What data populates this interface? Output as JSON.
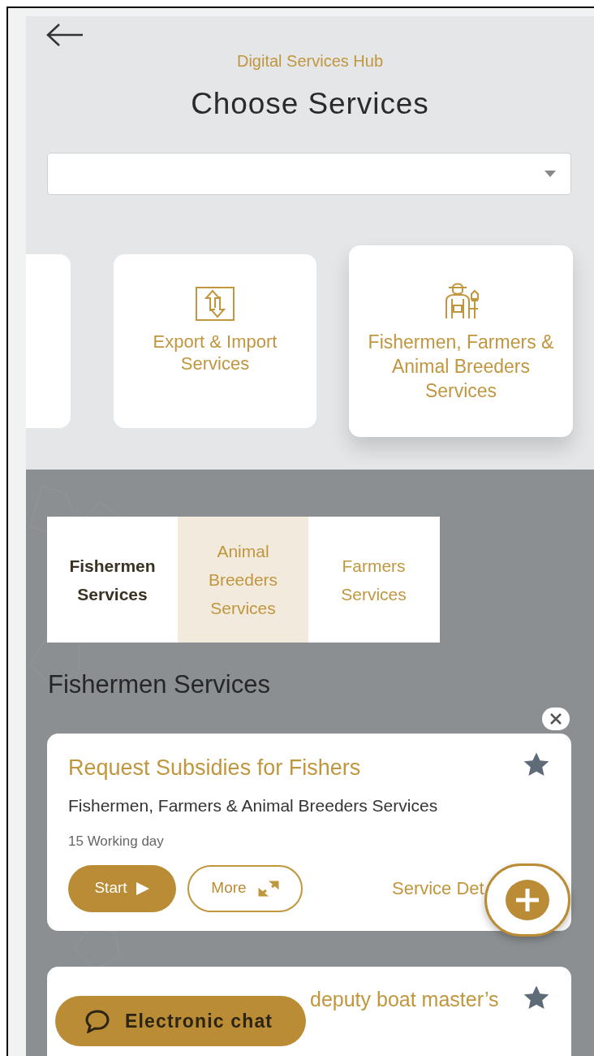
{
  "header": {
    "subtitle": "Digital Services Hub",
    "title": "Choose Services"
  },
  "categories": [
    {
      "kind": "partial",
      "selected": false
    },
    {
      "kind": "export",
      "label": "Export & Import Services",
      "selected": false
    },
    {
      "kind": "farmer",
      "label": "Fishermen, Farmers & Animal Breeders Services",
      "selected": true
    }
  ],
  "tabs": [
    {
      "label": "Fishermen Services",
      "selected": true,
      "hovered": false
    },
    {
      "label": "Animal Breeders Services",
      "selected": false,
      "hovered": true
    },
    {
      "label": "Farmers Services",
      "selected": false,
      "hovered": false
    }
  ],
  "section_title": "Fishermen Services",
  "services": [
    {
      "title": "Request Subsidies for Fishers",
      "category": "Fishermen, Farmers & Animal Breeders Services",
      "duration": "15 Working day",
      "start": "Start",
      "more": "More",
      "details": "Service Det",
      "favorite": true
    },
    {
      "title": "deputy boat master’s",
      "favorite": true
    }
  ],
  "chat": {
    "label": "Electronic chat"
  }
}
